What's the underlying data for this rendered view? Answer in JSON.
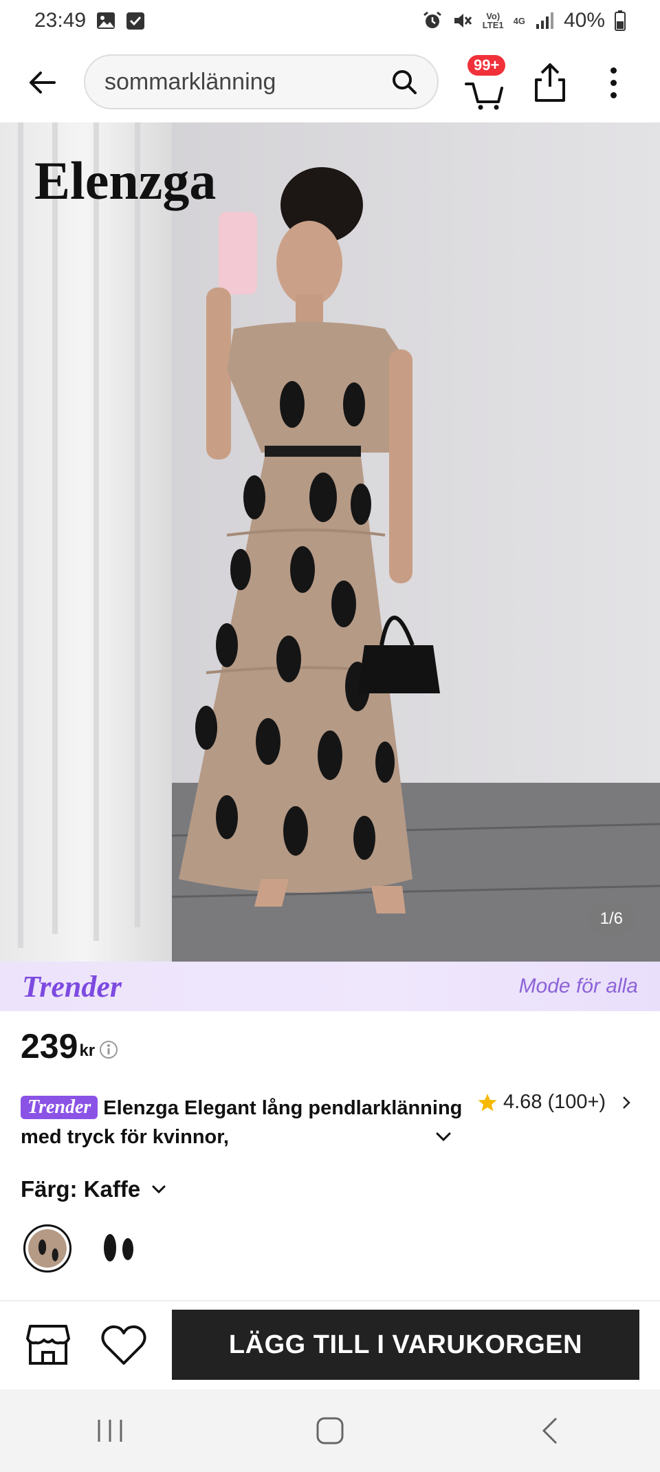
{
  "status_bar": {
    "time": "23:49",
    "battery": "40%",
    "volte_label": "Vo)\nLTE1",
    "network_label": "4G"
  },
  "search": {
    "value": "sommarklänning"
  },
  "cart": {
    "badge": "99+"
  },
  "product_image": {
    "brand_overlay": "Elenzga",
    "counter": "1/6"
  },
  "banner": {
    "logo": "Trender",
    "tagline": "Mode för alla"
  },
  "price": {
    "value": "239",
    "currency": "kr"
  },
  "product": {
    "tag": "Trender",
    "title": "Elenzga Elegant lång pendlarklänning med tryck för kvinnor,"
  },
  "rating": {
    "value": "4.68",
    "count": "(100+)"
  },
  "color": {
    "label": "Färg: Kaffe",
    "swatches": [
      {
        "name": "Kaffe",
        "color": "#b59a86",
        "selected": true
      },
      {
        "name": "Vit",
        "color": "#ffffff",
        "selected": false
      }
    ]
  },
  "actions": {
    "add_to_cart": "LÄGG TILL I VARUKORGEN"
  },
  "colors": {
    "accent_purple": "#8a53e6",
    "badge_red": "#f0313a",
    "button_dark": "#222222",
    "dress_beige": "#b59a86"
  }
}
